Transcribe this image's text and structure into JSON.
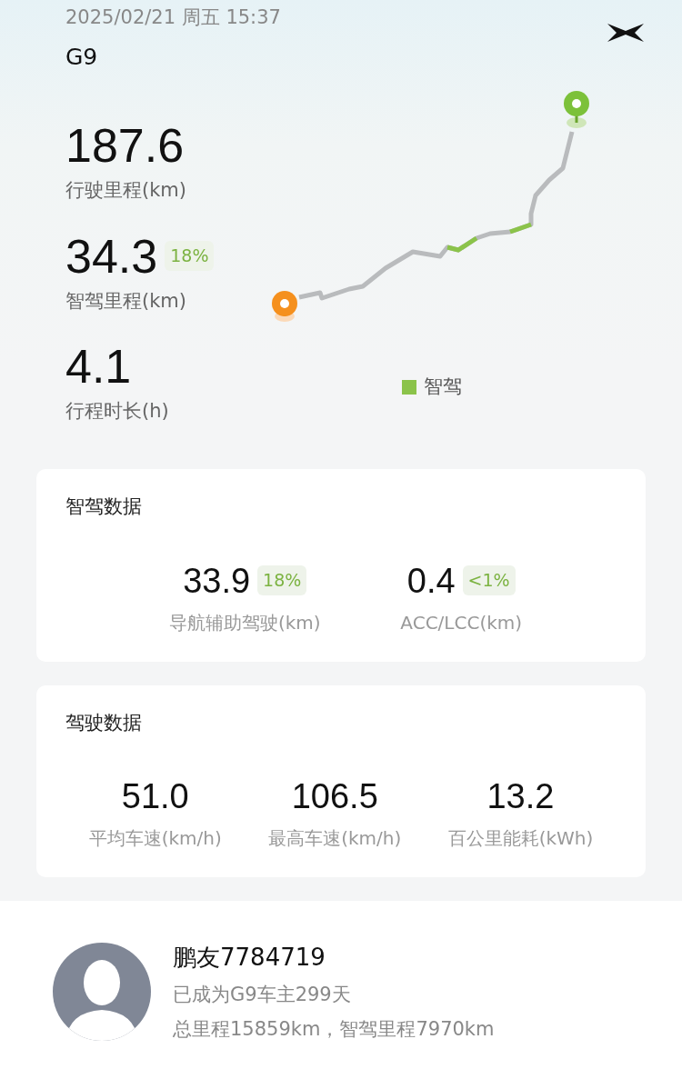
{
  "header": {
    "datetime": "2025/02/21 周五 15:37",
    "vehicle": "G9"
  },
  "trip_stats": [
    {
      "value": "187.6",
      "label": "行驶里程(km)"
    },
    {
      "value": "34.3",
      "badge": "18%",
      "label": "智驾里程(km)"
    },
    {
      "value": "4.1",
      "label": "行程时长(h)"
    }
  ],
  "map": {
    "legend": {
      "label": "智驾",
      "color": "#8bc34a"
    }
  },
  "cards": [
    {
      "title": "智驾数据",
      "metrics": [
        {
          "value": "33.9",
          "badge": "18%",
          "label": "导航辅助驾驶(km)"
        },
        {
          "value": "0.4",
          "badge": "<1%",
          "label": "ACC/LCC(km)"
        }
      ]
    },
    {
      "title": "驾驶数据",
      "metrics": [
        {
          "value": "51.0",
          "label": "平均车速(km/h)"
        },
        {
          "value": "106.5",
          "label": "最高车速(km/h)"
        },
        {
          "value": "13.2",
          "label": "百公里能耗(kWh)"
        }
      ]
    }
  ],
  "profile": {
    "name": "鹏友7784719",
    "ownership": "已成为G9车主299天",
    "totals": "总里程15859km，智驾里程7970km"
  }
}
